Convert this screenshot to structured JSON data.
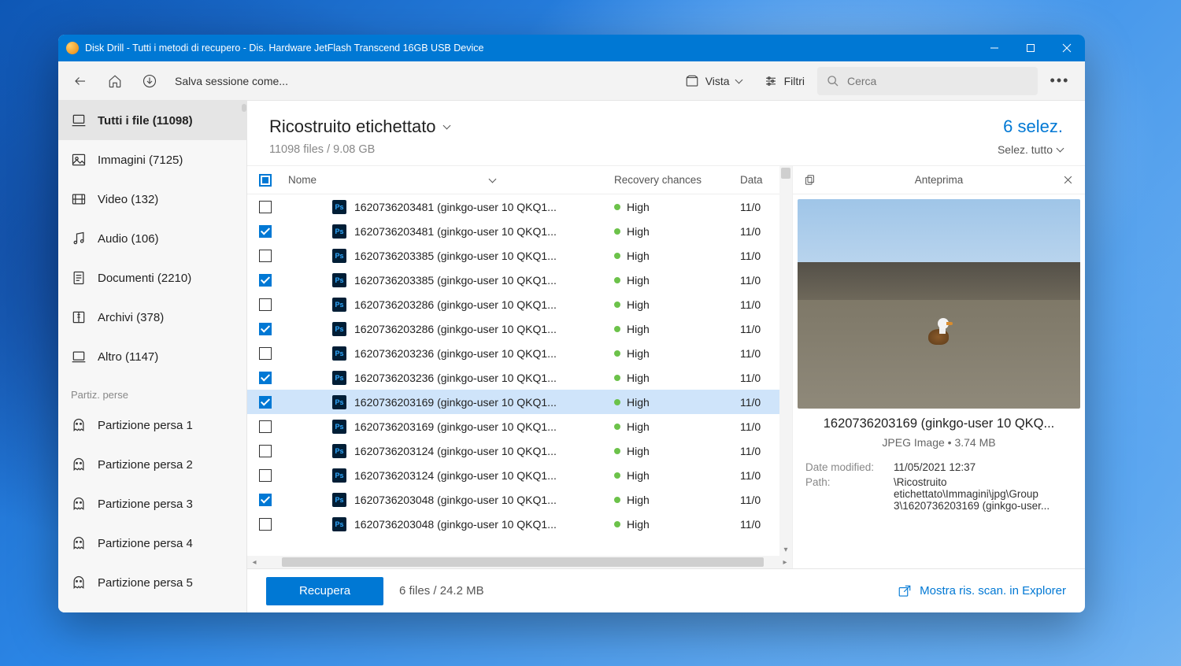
{
  "window_title": "Disk Drill - Tutti i metodi di recupero - Dis. Hardware JetFlash Transcend 16GB USB Device",
  "toolbar": {
    "save_session": "Salva sessione come...",
    "vista": "Vista",
    "filtri": "Filtri",
    "search_placeholder": "Cerca"
  },
  "sidebar": {
    "items": [
      {
        "label": "Tutti i file (11098)"
      },
      {
        "label": "Immagini (7125)"
      },
      {
        "label": "Video (132)"
      },
      {
        "label": "Audio (106)"
      },
      {
        "label": "Documenti (2210)"
      },
      {
        "label": "Archivi (378)"
      },
      {
        "label": "Altro (1147)"
      }
    ],
    "section": "Partiz. perse",
    "lost": [
      {
        "label": "Partizione persa 1"
      },
      {
        "label": "Partizione persa 2"
      },
      {
        "label": "Partizione persa 3"
      },
      {
        "label": "Partizione persa 4"
      },
      {
        "label": "Partizione persa 5"
      }
    ]
  },
  "main": {
    "title": "Ricostruito etichettato",
    "sub": "11098 files / 9.08 GB",
    "selected_count": "6 selez.",
    "select_all": "Selez. tutto"
  },
  "columns": {
    "name": "Nome",
    "recovery": "Recovery chances",
    "date": "Data"
  },
  "rows": [
    {
      "checked": false,
      "name": "1620736203481 (ginkgo-user 10 QKQ1...",
      "rec": "High",
      "date": "11/0"
    },
    {
      "checked": true,
      "name": "1620736203481 (ginkgo-user 10 QKQ1...",
      "rec": "High",
      "date": "11/0"
    },
    {
      "checked": false,
      "name": "1620736203385 (ginkgo-user 10 QKQ1...",
      "rec": "High",
      "date": "11/0"
    },
    {
      "checked": true,
      "name": "1620736203385 (ginkgo-user 10 QKQ1...",
      "rec": "High",
      "date": "11/0"
    },
    {
      "checked": false,
      "name": "1620736203286 (ginkgo-user 10 QKQ1...",
      "rec": "High",
      "date": "11/0"
    },
    {
      "checked": true,
      "name": "1620736203286 (ginkgo-user 10 QKQ1...",
      "rec": "High",
      "date": "11/0"
    },
    {
      "checked": false,
      "name": "1620736203236 (ginkgo-user 10 QKQ1...",
      "rec": "High",
      "date": "11/0"
    },
    {
      "checked": true,
      "name": "1620736203236 (ginkgo-user 10 QKQ1...",
      "rec": "High",
      "date": "11/0"
    },
    {
      "checked": true,
      "name": "1620736203169 (ginkgo-user 10 QKQ1...",
      "rec": "High",
      "date": "11/0",
      "selected": true
    },
    {
      "checked": false,
      "name": "1620736203169 (ginkgo-user 10 QKQ1...",
      "rec": "High",
      "date": "11/0"
    },
    {
      "checked": false,
      "name": "1620736203124 (ginkgo-user 10 QKQ1...",
      "rec": "High",
      "date": "11/0"
    },
    {
      "checked": false,
      "name": "1620736203124 (ginkgo-user 10 QKQ1...",
      "rec": "High",
      "date": "11/0"
    },
    {
      "checked": true,
      "name": "1620736203048 (ginkgo-user 10 QKQ1...",
      "rec": "High",
      "date": "11/0"
    },
    {
      "checked": false,
      "name": "1620736203048 (ginkgo-user 10 QKQ1...",
      "rec": "High",
      "date": "11/0"
    }
  ],
  "preview": {
    "title": "Anteprima",
    "name": "1620736203169 (ginkgo-user 10 QKQ...",
    "meta": "JPEG Image • 3.74 MB",
    "dm_label": "Date modified:",
    "dm_value": "11/05/2021 12:37",
    "path_label": "Path:",
    "path_value": "\\Ricostruito etichettato\\Immagini\\jpg\\Group 3\\1620736203169 (ginkgo-user..."
  },
  "footer": {
    "recover": "Recupera",
    "stats": "6 files / 24.2 MB",
    "explorer_link": "Mostra ris. scan. in Explorer"
  }
}
